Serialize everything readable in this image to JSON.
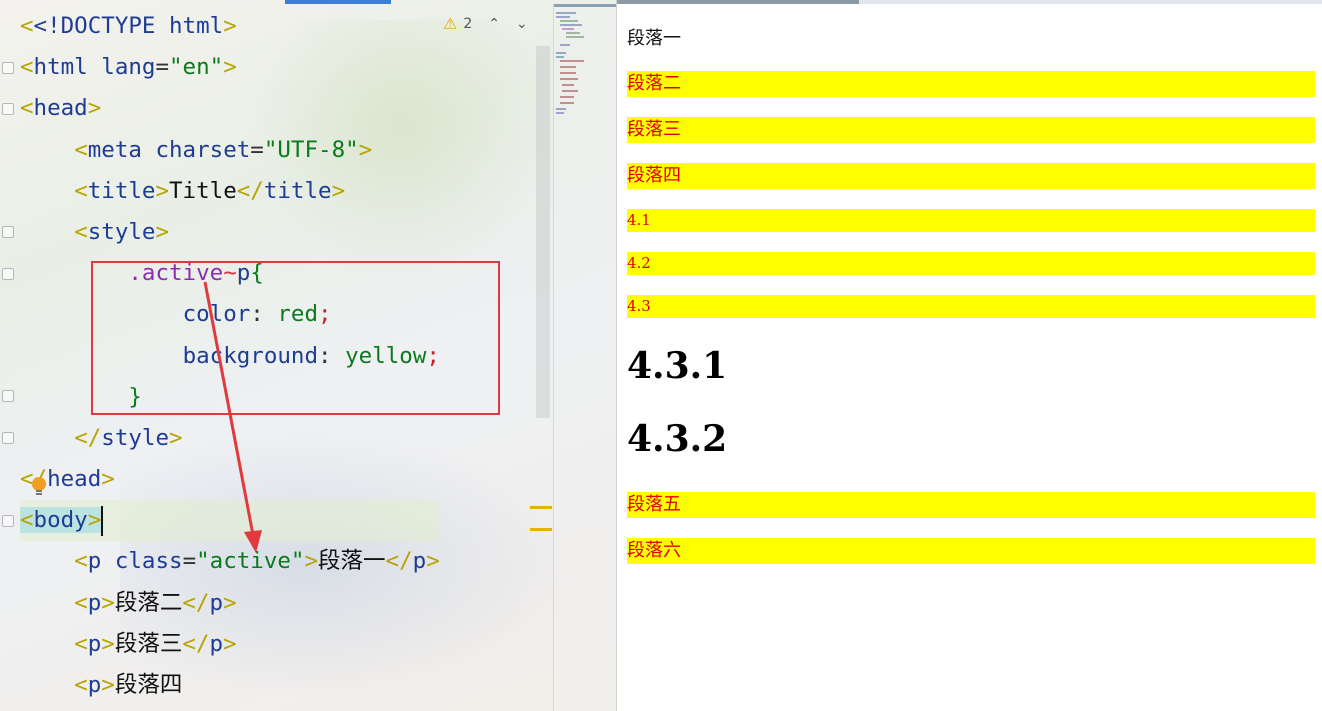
{
  "editor": {
    "inspection": {
      "warning_count": "2",
      "warning_icon": "warning-triangle-icon",
      "up_icon": "chevron-up-icon",
      "down_icon": "chevron-down-icon"
    },
    "code_lines": [
      "<!DOCTYPE html>",
      "<html lang=\"en\">",
      "<head>",
      "    <meta charset=\"UTF-8\">",
      "    <title>Title</title>",
      "    <style>",
      "        .active~p{",
      "            color: red;",
      "            background: yellow;",
      "        }",
      "    </style>",
      "</head>",
      "<body>",
      "    <p class=\"active\">段落一</p>",
      "    <p>段落二</p>",
      "    <p>段落三</p>",
      "    <p>段落四"
    ],
    "tokens": {
      "doctype": "<!DOCTYPE",
      "doctype_html": "html",
      "html": "html",
      "lang_attr": "lang",
      "lang_val": "\"en\"",
      "head": "head",
      "meta": "meta",
      "charset_attr": "charset",
      "charset_val": "\"UTF-8\"",
      "title": "title",
      "title_text": "Title",
      "style": "style",
      "selector_class": ".active",
      "combinator": "~",
      "selector_el": "p",
      "open_brace": "{",
      "close_brace": "}",
      "prop_color": "color",
      "val_red": "red",
      "prop_bg": "background",
      "val_yellow": "yellow",
      "body": "body",
      "p": "p",
      "class_attr": "class",
      "class_val": "\"active\"",
      "p1": "段落一",
      "p2": "段落二",
      "p3": "段落三",
      "p4": "段落四"
    },
    "lightbulb_icon": "lightbulb-icon"
  },
  "preview": {
    "paragraphs": [
      {
        "text": "段落一",
        "style": "normal"
      },
      {
        "text": "段落二",
        "style": "highlighted"
      },
      {
        "text": "段落三",
        "style": "highlighted"
      },
      {
        "text": "段落四",
        "style": "highlighted"
      },
      {
        "text": "4.1",
        "style": "highlighted"
      },
      {
        "text": "4.2",
        "style": "highlighted"
      },
      {
        "text": "4.3",
        "style": "highlighted"
      },
      {
        "text": "4.3.1",
        "style": "heading"
      },
      {
        "text": "4.3.2",
        "style": "heading"
      },
      {
        "text": "段落五",
        "style": "highlighted"
      },
      {
        "text": "段落六",
        "style": "highlighted"
      }
    ],
    "colors": {
      "highlight_bg": "#ffff00",
      "highlight_text": "#e00000"
    }
  },
  "annotation": {
    "box_color": "#e03a3e",
    "arrow_color": "#e03a3e"
  }
}
